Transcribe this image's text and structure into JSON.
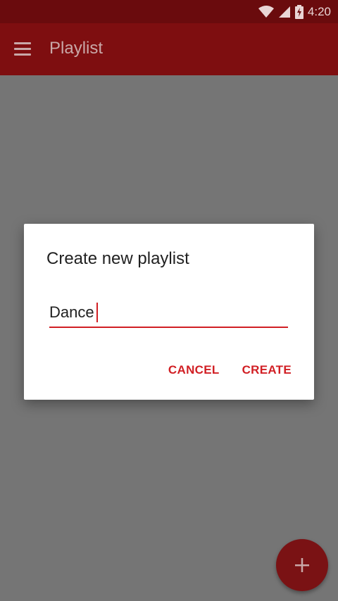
{
  "status_bar": {
    "time": "4:20",
    "icons": [
      "wifi-icon",
      "signal-icon",
      "battery-charging-icon"
    ]
  },
  "app_bar": {
    "title": "Playlist",
    "menu_icon": "menu-icon"
  },
  "dialog": {
    "title": "Create new playlist",
    "input_value": "Dance",
    "cancel_label": "CANCEL",
    "create_label": "CREATE"
  },
  "fab": {
    "icon": "plus-icon"
  },
  "colors": {
    "status_bar": "#6a0b0d",
    "app_bar": "#7e0e10",
    "accent": "#d11f24",
    "scrim": "#757575",
    "fab": "#7a1214"
  }
}
